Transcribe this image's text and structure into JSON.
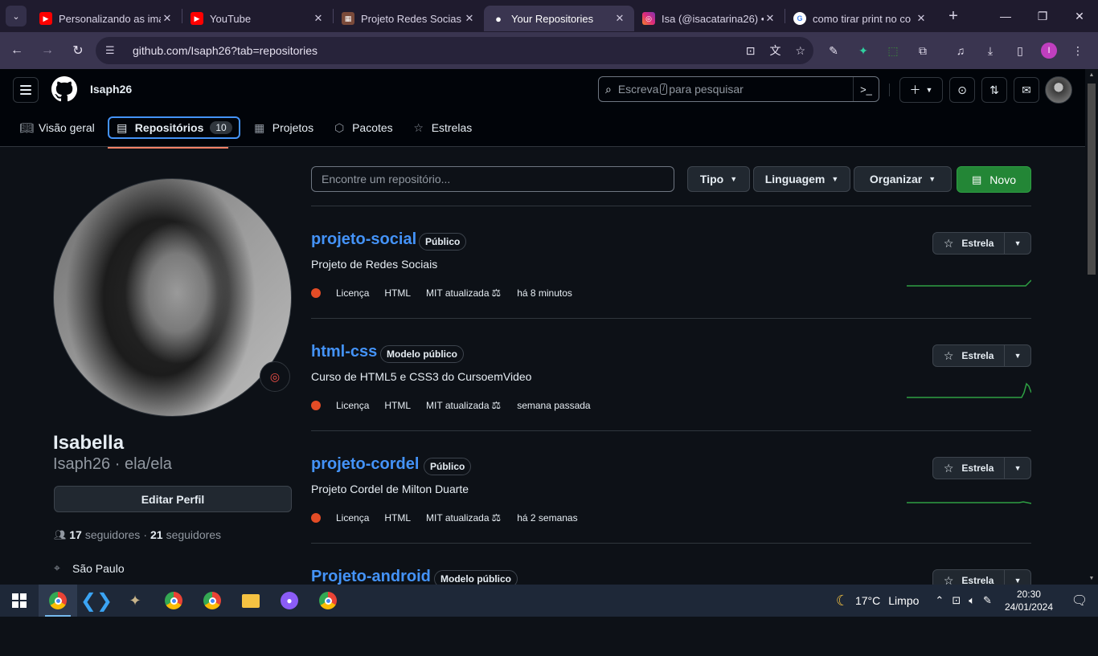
{
  "browser": {
    "tabs": [
      {
        "title": "Personalizando as ima",
        "icon": "youtube-icon",
        "color": "#ff0000"
      },
      {
        "title": "YouTube",
        "icon": "youtube-icon",
        "color": "#ff0000"
      },
      {
        "title": "Projeto Redes Socias",
        "icon": "page-icon",
        "color": "#e0835a"
      },
      {
        "title": "Your Repositories",
        "icon": "github-icon",
        "color": "#ffffff",
        "active": true
      },
      {
        "title": "Isa (@isacatarina26) •",
        "icon": "instagram-icon",
        "color": "#e1306c"
      },
      {
        "title": "como tirar print no co",
        "icon": "google-icon",
        "color": "#4285f4"
      }
    ],
    "url": "github.com/Isaph26?tab=repositories",
    "profile_initial": "I"
  },
  "header": {
    "username": "Isaph26",
    "search_placeholder_pre": "Escreva",
    "search_key": "/",
    "search_placeholder_post": "para pesquisar"
  },
  "nav": {
    "overview": "Visão geral",
    "repositories": "Repositórios",
    "repo_count": "10",
    "projects": "Projetos",
    "packages": "Pacotes",
    "stars": "Estrelas"
  },
  "profile": {
    "name": "Isabella",
    "login": "Isaph26 · ela/ela",
    "edit_label": "Editar Perfil",
    "followers_count": "17",
    "followers_label": "seguidores",
    "following_count": "21",
    "following_label": "seguidores",
    "location": "São Paulo"
  },
  "filters": {
    "search_placeholder": "Encontre um repositório...",
    "type": "Tipo",
    "language": "Linguagem",
    "sort": "Organizar",
    "new": "Novo"
  },
  "repos": [
    {
      "name": "projeto-social",
      "visibility": "Público",
      "description": "Projeto de Redes Sociais",
      "license": "Licença",
      "language": "HTML",
      "updated": "MIT atualizada",
      "when": "há 8 minutos"
    },
    {
      "name": "html-css",
      "visibility": "Modelo público",
      "description": "Curso de HTML5 e CSS3 do CursoemVideo",
      "license": "Licença",
      "language": "HTML",
      "updated": "MIT atualizada",
      "when": "semana passada"
    },
    {
      "name": "projeto-cordel",
      "visibility": "Público",
      "description": "Projeto Cordel de Milton Duarte",
      "license": "Licença",
      "language": "HTML",
      "updated": "MIT atualizada",
      "when": "há 2 semanas"
    },
    {
      "name": "Projeto-android",
      "visibility": "Modelo público",
      "description": "",
      "license": "",
      "language": "",
      "updated": "",
      "when": ""
    }
  ],
  "star_label": "Estrela",
  "taskbar": {
    "temperature": "17°C",
    "weather": "Limpo",
    "time": "20:30",
    "date": "24/01/2024"
  }
}
